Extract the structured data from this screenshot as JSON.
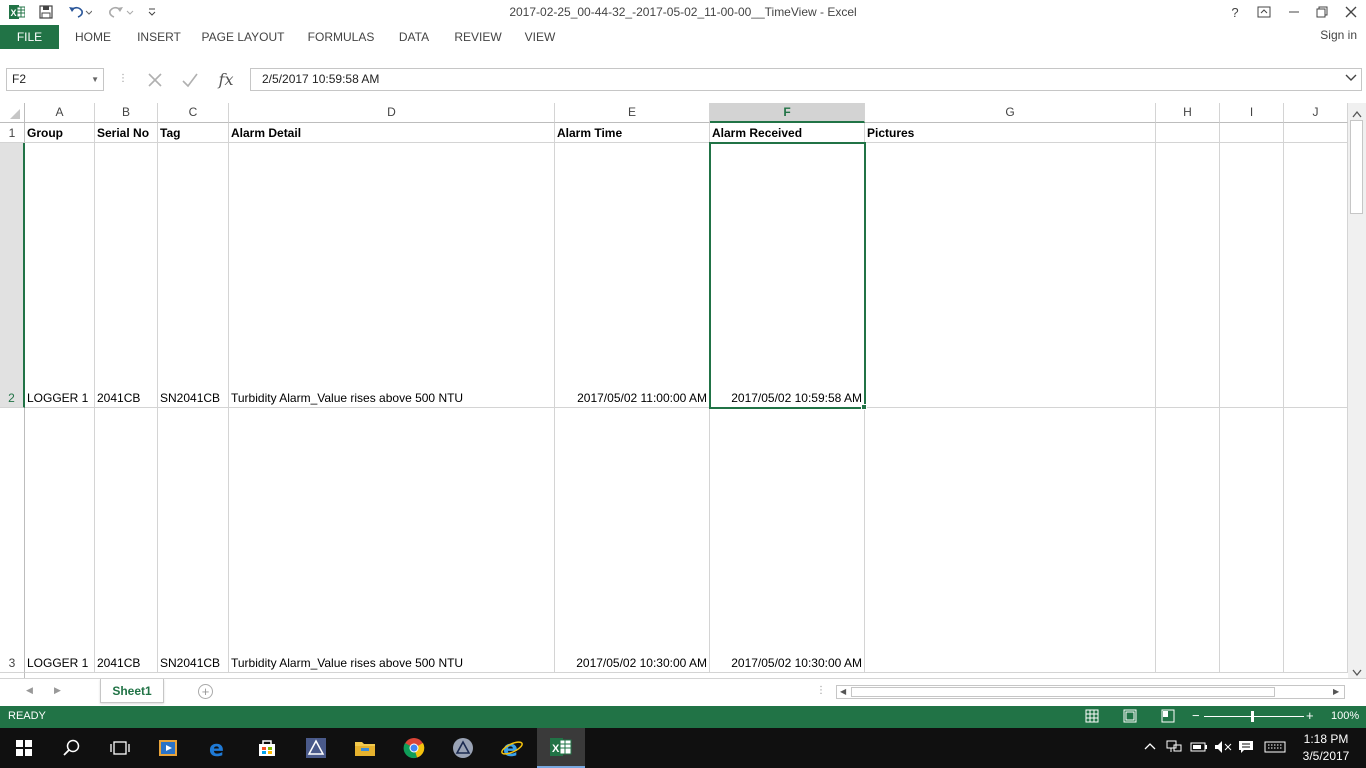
{
  "window": {
    "title": "2017-02-25_00-44-32_-2017-05-02_11-00-00__TimeView - Excel",
    "help": "?",
    "sign_in": "Sign in"
  },
  "ribbon_tabs": [
    "FILE",
    "HOME",
    "INSERT",
    "PAGE LAYOUT",
    "FORMULAS",
    "DATA",
    "REVIEW",
    "VIEW"
  ],
  "formula_bar": {
    "name_box": "F2",
    "fx": "fx",
    "formula": "2/5/2017  10:59:58 AM"
  },
  "columns": [
    "A",
    "B",
    "C",
    "D",
    "E",
    "F",
    "G",
    "H",
    "I",
    "J"
  ],
  "selected_column": "F",
  "rows": [
    {
      "num": "1",
      "cells": [
        "Group",
        "Serial No",
        "Tag",
        "Alarm Detail",
        "Alarm Time",
        "Alarm Received",
        "Pictures",
        "",
        "",
        ""
      ]
    },
    {
      "num": "2",
      "cells": [
        "LOGGER 1",
        "2041CB",
        "SN2041CB",
        "Turbidity Alarm_Value rises above 500 NTU",
        "2017/05/02 11:00:00 AM",
        "2017/05/02 10:59:58 AM",
        "",
        "",
        "",
        ""
      ]
    },
    {
      "num": "3",
      "cells": [
        "LOGGER 1",
        "2041CB",
        "SN2041CB",
        "Turbidity Alarm_Value rises above 500 NTU",
        "2017/05/02 10:30:00 AM",
        "2017/05/02 10:30:00 AM",
        "",
        "",
        "",
        ""
      ]
    }
  ],
  "sheets": [
    "Sheet1"
  ],
  "status": {
    "ready": "READY",
    "zoom": "100%"
  },
  "taskbar": {
    "time": "1:18 PM",
    "date": "3/5/2017"
  },
  "colors": {
    "excel_green": "#217346",
    "taskbar": "#101010"
  }
}
